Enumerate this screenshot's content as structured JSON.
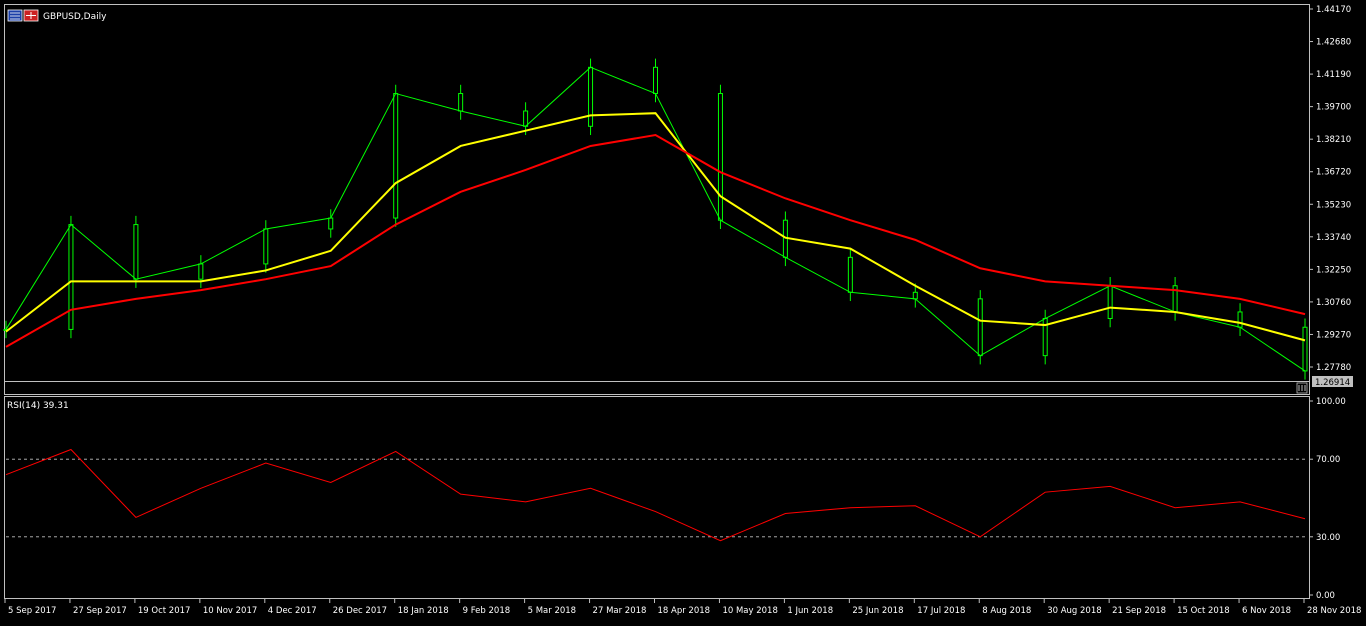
{
  "header": {
    "symbol_label": "GBPUSD,Daily",
    "rsi_label": "RSI(14) 39.31"
  },
  "price_axis": {
    "ticks": [
      "1.44170",
      "1.42680",
      "1.41190",
      "1.39700",
      "1.38210",
      "1.36720",
      "1.35230",
      "1.33740",
      "1.32250",
      "1.30760",
      "1.29270",
      "1.27780"
    ],
    "current_price": "1.26914"
  },
  "rsi_axis": {
    "ticks": [
      "100.00",
      "70.00",
      "30.00",
      "0.00"
    ]
  },
  "time_axis": {
    "ticks": [
      "5 Sep 2017",
      "27 Sep 2017",
      "19 Oct 2017",
      "10 Nov 2017",
      "4 Dec 2017",
      "26 Dec 2017",
      "18 Jan 2018",
      "9 Feb 2018",
      "5 Mar 2018",
      "27 Mar 2018",
      "18 Apr 2018",
      "10 May 2018",
      "1 Jun 2018",
      "25 Jun 2018",
      "17 Jul 2018",
      "8 Aug 2018",
      "30 Aug 2018",
      "21 Sep 2018",
      "15 Oct 2018",
      "6 Nov 2018",
      "28 Nov 2018"
    ]
  },
  "colors": {
    "background": "#000000",
    "candles": "#00ff00",
    "ma_fast": "#ffff00",
    "ma_slow": "#ff0000",
    "rsi_line": "#ff0000",
    "axis_text": "#ffffff",
    "grid_border": "#c0c0c0",
    "price_tag_bg": "#c0c0c0"
  },
  "chart_data": [
    {
      "type": "line",
      "panel": "price",
      "y_scale": {
        "min": 1.2691,
        "max": 1.4417
      },
      "x": [
        "5 Sep 2017",
        "27 Sep 2017",
        "19 Oct 2017",
        "10 Nov 2017",
        "4 Dec 2017",
        "26 Dec 2017",
        "18 Jan 2018",
        "9 Feb 2018",
        "5 Mar 2018",
        "27 Mar 2018",
        "18 Apr 2018",
        "10 May 2018",
        "1 Jun 2018",
        "25 Jun 2018",
        "17 Jul 2018",
        "8 Aug 2018",
        "30 Aug 2018",
        "21 Sep 2018",
        "15 Oct 2018",
        "6 Nov 2018",
        "28 Nov 2018"
      ],
      "series": [
        {
          "values": [
            1.295,
            1.343,
            1.318,
            1.325,
            1.341,
            1.346,
            1.403,
            1.395,
            1.388,
            1.415,
            1.403,
            1.345,
            1.328,
            1.312,
            1.309,
            1.283,
            1.3,
            1.315,
            1.303,
            1.296,
            1.276
          ],
          "color": "#00ff00"
        },
        {
          "values": [
            1.294,
            1.317,
            1.317,
            1.317,
            1.322,
            1.331,
            1.362,
            1.379,
            1.386,
            1.393,
            1.394,
            1.356,
            1.337,
            1.332,
            1.315,
            1.299,
            1.297,
            1.305,
            1.303,
            1.298,
            1.29
          ],
          "color": "#ffff00"
        },
        {
          "values": [
            1.287,
            1.304,
            1.309,
            1.313,
            1.318,
            1.324,
            1.343,
            1.358,
            1.368,
            1.379,
            1.384,
            1.367,
            1.355,
            1.345,
            1.336,
            1.323,
            1.317,
            1.315,
            1.313,
            1.309,
            1.302
          ],
          "color": "#ff0000"
        }
      ]
    },
    {
      "type": "line",
      "panel": "rsi",
      "ylim": [
        0,
        100
      ],
      "levels": [
        70,
        30
      ],
      "x": [
        "5 Sep 2017",
        "27 Sep 2017",
        "19 Oct 2017",
        "10 Nov 2017",
        "4 Dec 2017",
        "26 Dec 2017",
        "18 Jan 2018",
        "9 Feb 2018",
        "5 Mar 2018",
        "27 Mar 2018",
        "18 Apr 2018",
        "10 May 2018",
        "1 Jun 2018",
        "25 Jun 2018",
        "17 Jul 2018",
        "8 Aug 2018",
        "30 Aug 2018",
        "21 Sep 2018",
        "15 Oct 2018",
        "6 Nov 2018",
        "28 Nov 2018"
      ],
      "series": [
        {
          "values": [
            62,
            75,
            40,
            55,
            68,
            58,
            74,
            52,
            48,
            55,
            43,
            28,
            42,
            45,
            46,
            30,
            53,
            56,
            45,
            48,
            39.31
          ],
          "color": "#ff0000"
        }
      ]
    }
  ]
}
